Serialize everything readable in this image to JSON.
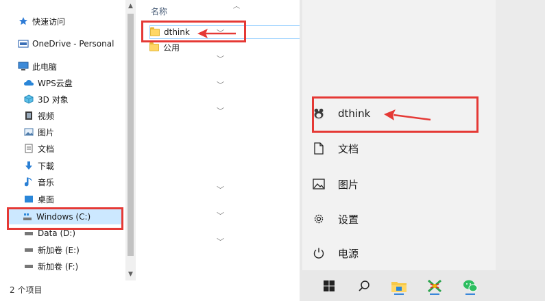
{
  "explorer": {
    "nav": {
      "quick_access": "快速访问",
      "onedrive": "OneDrive - Personal",
      "this_pc": "此电脑",
      "items": [
        {
          "label": "WPS云盘",
          "icon": "cloud-icon"
        },
        {
          "label": "3D 对象",
          "icon": "cube-icon"
        },
        {
          "label": "视频",
          "icon": "video-icon"
        },
        {
          "label": "图片",
          "icon": "pictures-icon"
        },
        {
          "label": "文档",
          "icon": "document-icon"
        },
        {
          "label": "下載",
          "icon": "download-icon"
        },
        {
          "label": "音乐",
          "icon": "music-icon"
        },
        {
          "label": "桌面",
          "icon": "desktop-icon"
        }
      ],
      "drives": [
        {
          "label": "Windows (C:)",
          "selected": true
        },
        {
          "label": "Data (D:)"
        },
        {
          "label": "新加卷 (E:)"
        },
        {
          "label": "新加卷 (F:)"
        }
      ]
    },
    "list": {
      "column_name": "名称",
      "files": [
        {
          "name": "dthink",
          "highlighted": true
        },
        {
          "name": "公用"
        }
      ]
    },
    "status": "2 个项目"
  },
  "start_menu": {
    "user": "dthink",
    "documents": "文档",
    "pictures": "图片",
    "settings": "设置",
    "power": "电源"
  },
  "colors": {
    "annotation_red": "#e53935",
    "selection_blue": "#cce8ff",
    "folder_yellow": "#ffd766"
  }
}
